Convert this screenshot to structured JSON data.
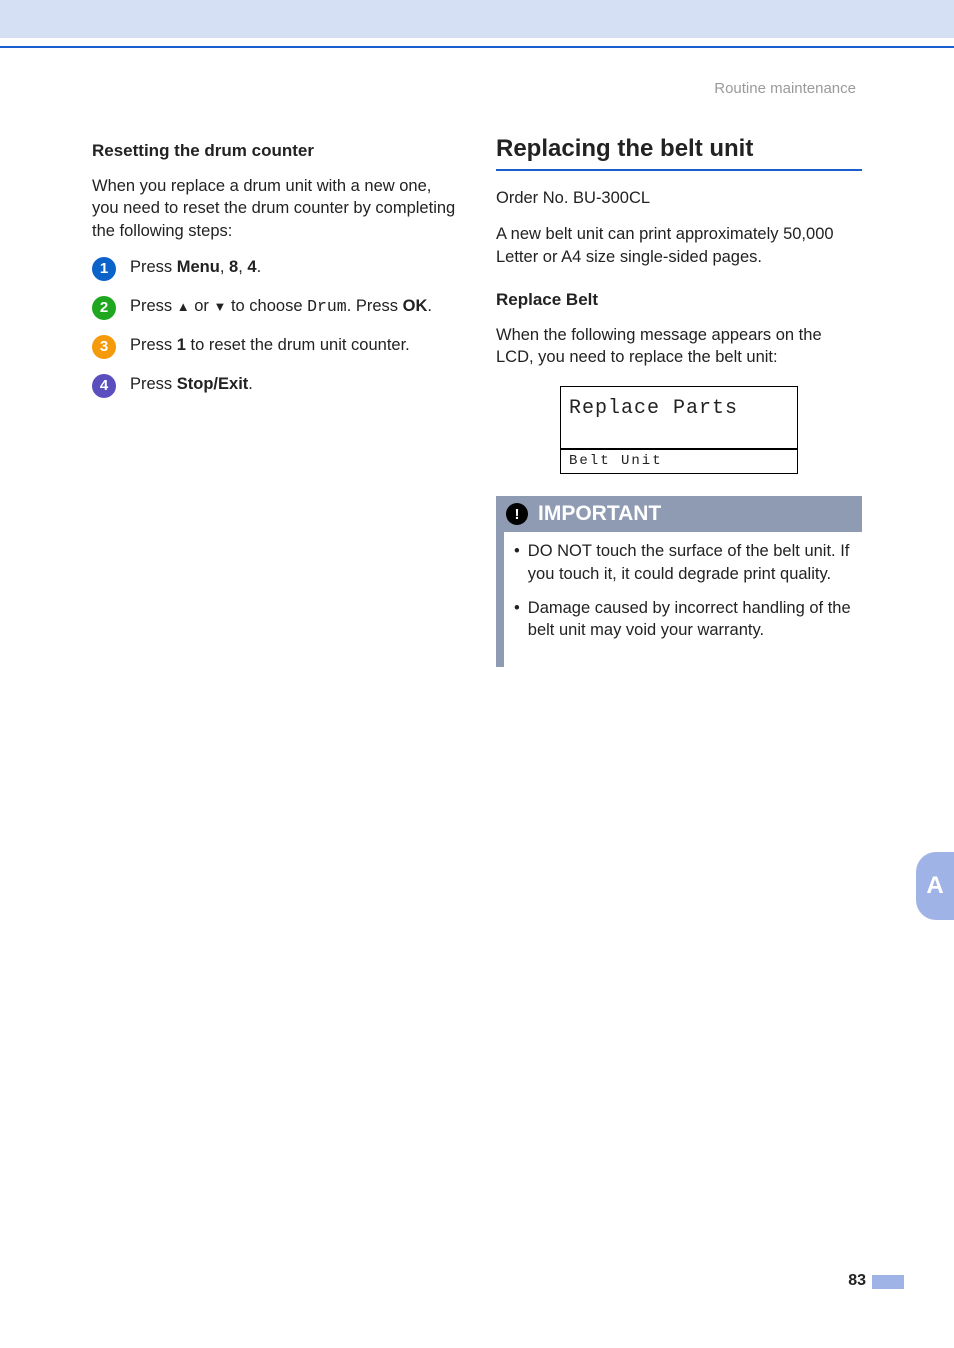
{
  "header": {
    "running_title": "Routine maintenance"
  },
  "left": {
    "title": "Resetting the drum counter",
    "intro": "When you replace a drum unit with a new one, you need to reset the drum counter by completing the following steps:",
    "steps": [
      {
        "n": "1",
        "pre": "Press ",
        "b1": "Menu",
        "mid1": ", ",
        "b2": "8",
        "mid2": ", ",
        "b3": "4",
        "post": "."
      },
      {
        "n": "2",
        "parts": {
          "press": "Press ",
          "or": " or ",
          "choose": " to choose ",
          "drum": "Drum",
          "pressok": ". Press ",
          "ok": "OK",
          "end": "."
        }
      },
      {
        "n": "3",
        "parts": {
          "press": "Press ",
          "one": "1",
          "rest": " to reset the drum unit counter."
        }
      },
      {
        "n": "4",
        "parts": {
          "press": "Press ",
          "stopexit": "Stop/Exit",
          "end": "."
        }
      }
    ]
  },
  "right": {
    "h2": "Replacing the belt unit",
    "order": "Order No. BU-300CL",
    "desc": "A new belt unit can print approximately 50,000 Letter or A4 size single-sided pages.",
    "sub": "Replace Belt",
    "sub_desc": "When the following message appears on the LCD, you need to replace the belt unit:",
    "lcd": {
      "line1": "Replace Parts",
      "line2": "Belt Unit"
    },
    "important": {
      "title": "IMPORTANT",
      "items": [
        "DO NOT touch the surface of the belt unit. If you touch it, it could degrade print quality.",
        "Damage caused by incorrect handling of the belt unit may void your warranty."
      ]
    }
  },
  "tab": "A",
  "page_number": "83",
  "glyphs": {
    "up": "▲",
    "down": "▼"
  }
}
